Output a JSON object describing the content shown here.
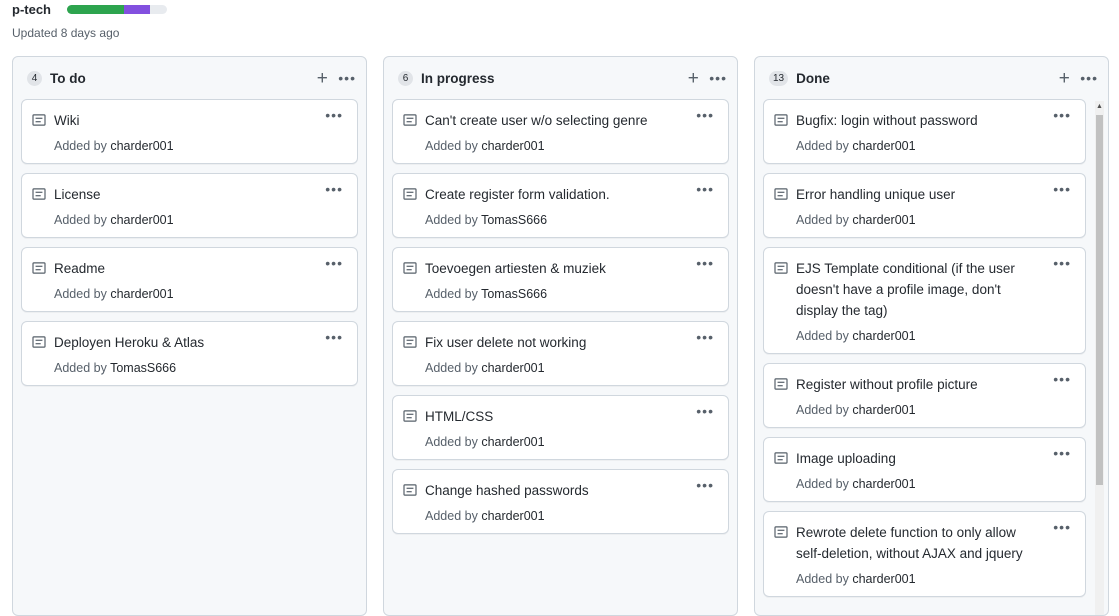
{
  "project": {
    "name": "p-tech",
    "updated": "Updated 8 days ago",
    "progress": {
      "done_fraction": 0.57,
      "in_progress_fraction": 0.26,
      "done_color": "#2da44e",
      "in_progress_color": "#8250df",
      "todo_color": "#e8ebef"
    }
  },
  "icons": {
    "add": "plus-icon",
    "menu": "kebab-menu-icon",
    "note": "note-icon"
  },
  "columns": [
    {
      "count": "4",
      "title": "To do",
      "cards": [
        {
          "title": "Wiki",
          "added_by": "Added by",
          "user": "charder001"
        },
        {
          "title": "License",
          "added_by": "Added by",
          "user": "charder001"
        },
        {
          "title": "Readme",
          "added_by": "Added by",
          "user": "charder001"
        },
        {
          "title": "Deployen Heroku & Atlas",
          "added_by": "Added by",
          "user": "TomasS666"
        }
      ]
    },
    {
      "count": "6",
      "title": "In progress",
      "cards": [
        {
          "title": "Can't create user w/o selecting genre",
          "added_by": "Added by",
          "user": "charder001"
        },
        {
          "title": "Create register form validation.",
          "added_by": "Added by",
          "user": "TomasS666"
        },
        {
          "title": "Toevoegen artiesten & muziek",
          "added_by": "Added by",
          "user": "TomasS666"
        },
        {
          "title": "Fix user delete not working",
          "added_by": "Added by",
          "user": "charder001"
        },
        {
          "title": "HTML/CSS",
          "added_by": "Added by",
          "user": "charder001"
        },
        {
          "title": "Change hashed passwords",
          "added_by": "Added by",
          "user": "charder001"
        }
      ]
    },
    {
      "count": "13",
      "title": "Done",
      "cards": [
        {
          "title": "Bugfix: login without password",
          "added_by": "Added by",
          "user": "charder001"
        },
        {
          "title": "Error handling unique user",
          "added_by": "Added by",
          "user": "charder001"
        },
        {
          "title": "EJS Template conditional (if the user doesn't have a profile image, don't display the  tag)",
          "added_by": "Added by",
          "user": "charder001"
        },
        {
          "title": "Register without profile picture",
          "added_by": "Added by",
          "user": "charder001"
        },
        {
          "title": "Image uploading",
          "added_by": "Added by",
          "user": "charder001"
        },
        {
          "title": "Rewrote delete function to only allow self-deletion, without AJAX and jquery",
          "added_by": "Added by",
          "user": "charder001"
        }
      ]
    }
  ]
}
